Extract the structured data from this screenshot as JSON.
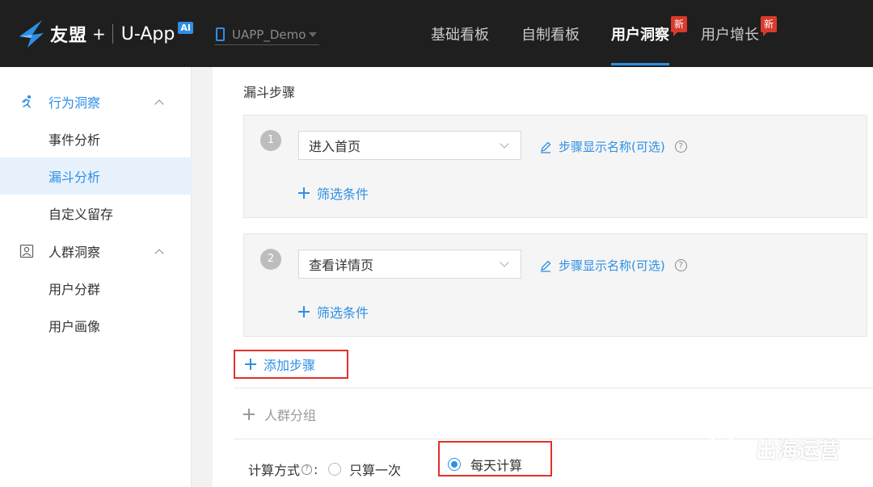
{
  "header": {
    "brand_cn": "友盟",
    "brand_plus": "+",
    "brand_en": "U-App",
    "brand_ai": "AI",
    "app_name": "UAPP_Demo",
    "nav": [
      {
        "label": "基础看板",
        "active": false,
        "badge": ""
      },
      {
        "label": "自制看板",
        "active": false,
        "badge": ""
      },
      {
        "label": "用户洞察",
        "active": true,
        "badge": "新"
      },
      {
        "label": "用户增长",
        "active": false,
        "badge": "新"
      }
    ]
  },
  "sidebar": {
    "groups": [
      {
        "label": "行为洞察",
        "icon": "running-person-icon",
        "items": [
          "事件分析",
          "漏斗分析",
          "自定义留存"
        ]
      },
      {
        "label": "人群洞察",
        "icon": "user-card-icon",
        "items": [
          "用户分群",
          "用户画像"
        ]
      }
    ],
    "active_item": "漏斗分析"
  },
  "main": {
    "section_title": "漏斗步骤",
    "steps": [
      {
        "number": "1",
        "event": "进入首页",
        "rename_label": "步骤显示名称(可选)",
        "filter_label": "筛选条件"
      },
      {
        "number": "2",
        "event": "查看详情页",
        "rename_label": "步骤显示名称(可选)",
        "filter_label": "筛选条件"
      }
    ],
    "add_step_label": "添加步骤",
    "crowd_group_label": "人群分组",
    "calc": {
      "label": "计算方式",
      "colon": ":",
      "options": [
        {
          "label": "只算一次",
          "selected": false
        },
        {
          "label": "每天计算",
          "selected": true
        }
      ]
    }
  },
  "watermark": {
    "text": "出海运营"
  },
  "colors": {
    "accent": "#2e8fe6",
    "highlight_box": "#e0312b",
    "badge": "#d93a2b",
    "topbar": "#1f1f1f"
  }
}
